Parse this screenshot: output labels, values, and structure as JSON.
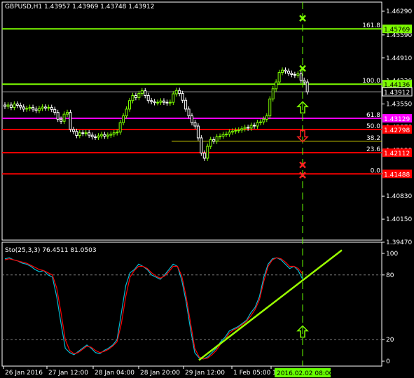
{
  "header": {
    "symbol_text": "GBPUSD,H1  1.43957 1.43969 1.43748 1.43912",
    "indicator_text": "Sto(25,3,3) 76.4511 81.0503"
  },
  "colors": {
    "background": "#000000",
    "axis": "#ffffff",
    "grid_dash": "#7f7f7f",
    "bull_candle": "#7cfc00",
    "bear_candle": "#ffffff",
    "fib_green": "#7cfc00",
    "fib_magenta": "#ff00ff",
    "fib_red": "#ff0000",
    "stoch_main": "#00bcd4",
    "stoch_signal": "#ff0000",
    "trendline": "#9aff00",
    "cursor_line": "#66ff00",
    "cursor_label_bg": "#66ff00"
  },
  "chart_data": [
    {
      "type": "candlestick",
      "symbol": "GBPUSD",
      "timeframe": "H1",
      "y_ticks": [
        "1.46290",
        "1.45590",
        "1.44910",
        "1.44230",
        "1.43550",
        "1.42870",
        "1.42190",
        "1.41510",
        "1.40830",
        "1.40150",
        "1.39470"
      ],
      "ylim": [
        1.3947,
        1.4629
      ],
      "x_ticks": [
        "26 Jan 2016",
        "27 Jan 12:00",
        "28 Jan 04:00",
        "28 Jan 20:00",
        "29 Jan 12:00",
        "1 Feb 05:00",
        "1"
      ],
      "current_price": "1.43912",
      "series": [
        {
          "name": "close",
          "values": [
            1.4348,
            1.4352,
            1.4345,
            1.4355,
            1.4351,
            1.4346,
            1.434,
            1.4342,
            1.4345,
            1.434,
            1.4336,
            1.4342,
            1.4346,
            1.4343,
            1.4345,
            1.4339,
            1.433,
            1.431,
            1.4304,
            1.4325,
            1.433,
            1.428,
            1.4274,
            1.4262,
            1.427,
            1.4268,
            1.427,
            1.4263,
            1.4258,
            1.4257,
            1.4261,
            1.4265,
            1.426,
            1.4263,
            1.4266,
            1.427,
            1.4272,
            1.43,
            1.432,
            1.434,
            1.4365,
            1.438,
            1.4374,
            1.4386,
            1.4394,
            1.438,
            1.4365,
            1.4362,
            1.4359,
            1.436,
            1.4364,
            1.436,
            1.4358,
            1.436,
            1.4385,
            1.4395,
            1.4386,
            1.4366,
            1.434,
            1.432,
            1.43,
            1.429,
            1.4255,
            1.421,
            1.4195,
            1.423,
            1.425,
            1.4245,
            1.4258,
            1.426,
            1.4265,
            1.4266,
            1.4272,
            1.4275,
            1.4277,
            1.4278,
            1.4282,
            1.4286,
            1.4284,
            1.4292,
            1.429,
            1.43,
            1.4302,
            1.431,
            1.432,
            1.437,
            1.44,
            1.442,
            1.4448,
            1.4455,
            1.4452,
            1.4446,
            1.4442,
            1.444,
            1.4444,
            1.4425,
            1.442,
            1.4391
          ]
        }
      ],
      "fibonacci_levels": [
        {
          "ratio": "161.8",
          "price": "1.45769"
        },
        {
          "ratio": "100.0",
          "price": "1.44136"
        },
        {
          "ratio": "61.8",
          "price": "1.43129"
        },
        {
          "ratio": "50.0",
          "price": "1.42798"
        },
        {
          "ratio": "38.2",
          "price": ""
        },
        {
          "ratio": "23.6",
          "price": "1.42112"
        },
        {
          "ratio": "0.0",
          "price": "1.41488"
        }
      ],
      "markers": [
        {
          "shape": "x",
          "color": "green",
          "price": 1.4608
        },
        {
          "shape": "x",
          "color": "green",
          "price": 1.446
        },
        {
          "shape": "arrow-up",
          "color": "green",
          "price": 1.4345
        },
        {
          "shape": "arrow-down",
          "color": "red",
          "price": 1.426
        },
        {
          "shape": "x",
          "color": "red",
          "price": 1.4175
        },
        {
          "shape": "x",
          "color": "red",
          "price": 1.4145
        }
      ]
    },
    {
      "type": "line",
      "name": "Sto(25,3,3)",
      "y_ticks": [
        "100",
        "80",
        "20",
        "0"
      ],
      "ylim": [
        0,
        100
      ],
      "levels": [
        80,
        20
      ],
      "cursor_label": "2016.02.02 08:00",
      "series": [
        {
          "name": "main",
          "values": [
            95,
            96,
            94,
            93,
            91,
            90,
            88,
            85,
            83,
            84,
            80,
            78,
            60,
            35,
            12,
            8,
            6,
            9,
            12,
            15,
            12,
            8,
            7,
            10,
            12,
            15,
            20,
            45,
            70,
            82,
            85,
            90,
            88,
            85,
            80,
            78,
            76,
            80,
            85,
            90,
            88,
            75,
            55,
            30,
            8,
            3,
            2,
            4,
            8,
            12,
            18,
            22,
            28,
            30,
            32,
            35,
            38,
            45,
            50,
            60,
            78,
            90,
            95,
            96,
            94,
            90,
            86,
            88,
            84,
            76
          ]
        },
        {
          "name": "signal",
          "values": [
            94,
            95,
            94,
            93,
            92,
            91,
            89,
            87,
            85,
            84,
            82,
            80,
            68,
            45,
            20,
            10,
            7,
            8,
            11,
            14,
            13,
            10,
            8,
            9,
            11,
            14,
            18,
            35,
            60,
            78,
            84,
            88,
            88,
            86,
            82,
            79,
            77,
            79,
            83,
            88,
            88,
            79,
            60,
            36,
            12,
            4,
            2,
            3,
            6,
            10,
            16,
            20,
            26,
            29,
            31,
            34,
            37,
            42,
            48,
            57,
            74,
            88,
            94,
            96,
            95,
            92,
            88,
            88,
            86,
            81
          ]
        }
      ],
      "markers": [
        {
          "shape": "arrow-up",
          "color": "green",
          "value": 34
        }
      ]
    }
  ]
}
